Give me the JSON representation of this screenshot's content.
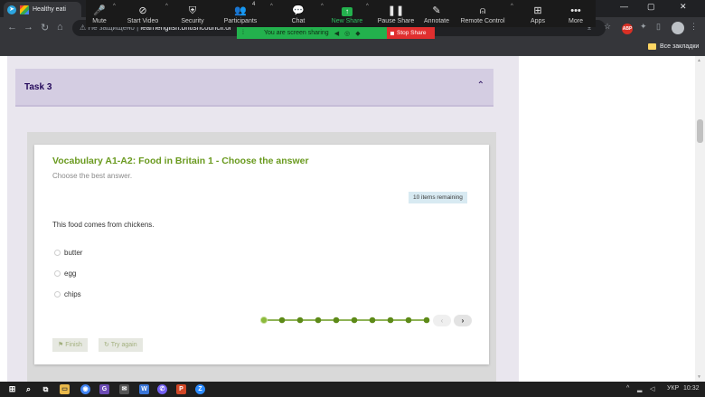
{
  "browser": {
    "tab_title": "Healthy eati",
    "window_controls": {
      "minimize": "—",
      "maximize": "▢",
      "close": "✕"
    },
    "address_security": "Не защищено",
    "address_url": "learnenglish.britishcouncil.or",
    "bookmarks_label": "Все закладки",
    "extension_badge": "ABP"
  },
  "zoom": {
    "buttons": [
      {
        "label": "Mute",
        "icon": "🎤"
      },
      {
        "label": "Start Video",
        "icon": "⊘"
      },
      {
        "label": "Security",
        "icon": "⛨"
      },
      {
        "label": "Participants",
        "icon": "👥",
        "count": "4"
      },
      {
        "label": "Chat",
        "icon": "💬"
      },
      {
        "label": "New Share",
        "icon": "↑"
      },
      {
        "label": "Pause Share",
        "icon": "❚❚"
      },
      {
        "label": "Annotate",
        "icon": "✎"
      },
      {
        "label": "Remote Control",
        "icon": "⍝"
      },
      {
        "label": "Apps",
        "icon": "⊞"
      },
      {
        "label": "More",
        "icon": "•••"
      }
    ],
    "sharing_text": "You are screen sharing",
    "stop_share": "Stop Share",
    "colors": {
      "bar": "#1a1a1a",
      "share_green": "#23b14d",
      "stop_red": "#e02f2f"
    }
  },
  "page": {
    "task_title": "Task 3",
    "quiz_title": "Vocabulary A1-A2: Food in Britain 1 - Choose the answer",
    "instructions": "Choose the best answer.",
    "remaining": "10 items remaining",
    "question": "This food comes from chickens.",
    "options": [
      "butter",
      "egg",
      "chips"
    ],
    "progress": {
      "total": 10,
      "current": 1
    },
    "finish_label": "Finish",
    "try_again_label": "Try again",
    "colors": {
      "accent": "#6a9a1f",
      "task_header": "#d4cde2",
      "task_text": "#23085a"
    }
  },
  "taskbar": {
    "language": "УКР",
    "time": "10:32",
    "apps": [
      "chrome",
      "G",
      "email",
      "viber",
      "powerpoint",
      "zoom"
    ]
  }
}
